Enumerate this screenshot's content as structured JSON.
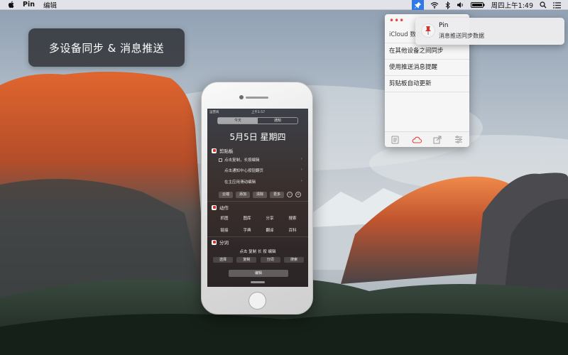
{
  "menubar": {
    "app_name": "Pin",
    "menu_edit": "编辑",
    "clock": "周四上午1:49"
  },
  "overlay": {
    "title": "多设备同步 & 消息推送"
  },
  "pin_panel": {
    "items": [
      "iCloud 数据",
      "在其他设备之间同步",
      "使用推送消息提醒",
      "剪贴板自动更新"
    ],
    "footer_icons": [
      "clipboard-icon",
      "cloud-icon",
      "share-icon",
      "settings-icon"
    ],
    "accent_color": "#e2453c"
  },
  "notification": {
    "title": "Pin",
    "body": "消息推送同步数据"
  },
  "iphone": {
    "status": {
      "carrier": "运营商",
      "time": "上午1:57"
    },
    "segments": [
      "今天",
      "通知"
    ],
    "date": "5月5日 星期四",
    "clipboard": {
      "title": "剪贴板",
      "rows": [
        "点击复制，长按编辑",
        "点击通知中心按钮翻页",
        "在主应用滑动编辑"
      ],
      "buttons": [
        "云端",
        "添加",
        "清除",
        "更多"
      ]
    },
    "actions": {
      "title": "动作",
      "items": [
        "抓图",
        "图库",
        "分享",
        "搜索",
        "链接",
        "字典",
        "翻译",
        "百科"
      ]
    },
    "words": {
      "title": "分词",
      "line": "点击 复制 长 按 编辑",
      "buttons": [
        "选择",
        "复制",
        "分词",
        "搜索"
      ]
    },
    "edit_label": "编辑"
  }
}
